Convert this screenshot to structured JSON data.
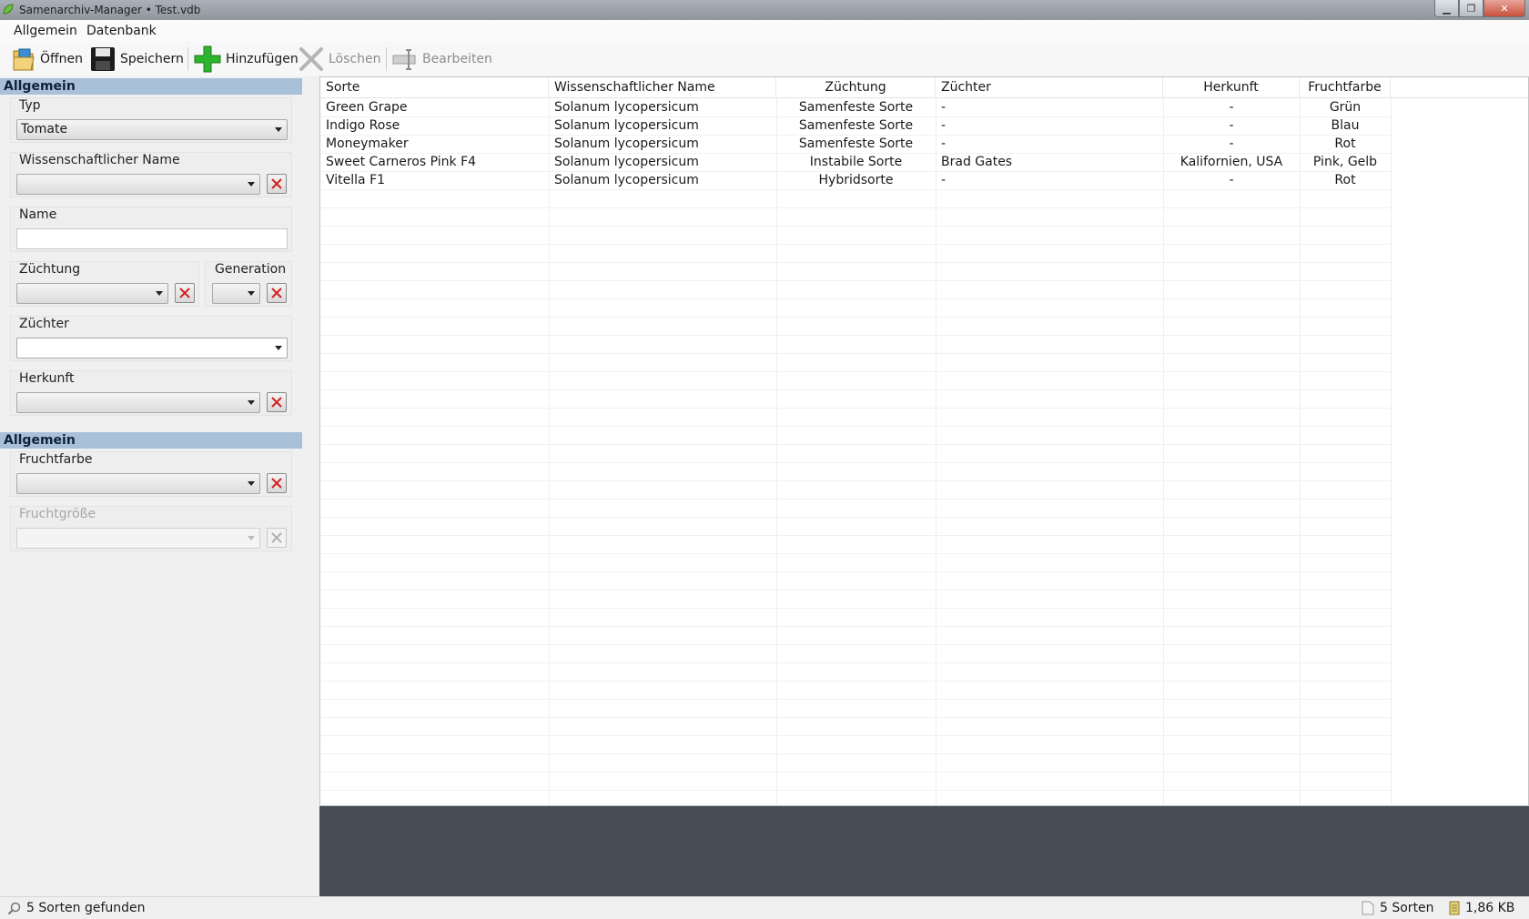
{
  "window": {
    "title": "Samenarchiv-Manager • Test.vdb"
  },
  "menu": {
    "items": [
      "Allgemein",
      "Datenbank"
    ]
  },
  "toolbar": {
    "open": "Öffnen",
    "save": "Speichern",
    "add": "Hinzufügen",
    "delete": "Löschen",
    "edit": "Bearbeiten"
  },
  "filters": {
    "section1": "Allgemein",
    "typ_label": "Typ",
    "typ_value": "Tomate",
    "sci_label": "Wissenschaftlicher Name",
    "sci_value": "",
    "name_label": "Name",
    "name_value": "",
    "zuechtung_label": "Züchtung",
    "zuechtung_value": "",
    "generation_label": "Generation",
    "generation_value": "",
    "zuechter_label": "Züchter",
    "zuechter_value": "",
    "herkunft_label": "Herkunft",
    "herkunft_value": "",
    "section2": "Allgemein",
    "fruchtfarbe_label": "Fruchtfarbe",
    "fruchtfarbe_value": "",
    "fruchtgroesse_label": "Fruchtgröße",
    "fruchtgroesse_value": ""
  },
  "table": {
    "columns": [
      "Sorte",
      "Wissenschaftlicher Name",
      "Züchtung",
      "Züchter",
      "Herkunft",
      "Fruchtfarbe"
    ],
    "rows": [
      [
        "Green Grape",
        "Solanum lycopersicum",
        "Samenfeste Sorte",
        "-",
        "-",
        "Grün"
      ],
      [
        "Indigo Rose",
        "Solanum lycopersicum",
        "Samenfeste Sorte",
        "-",
        "-",
        "Blau"
      ],
      [
        "Moneymaker",
        "Solanum lycopersicum",
        "Samenfeste Sorte",
        "-",
        "-",
        "Rot"
      ],
      [
        "Sweet Carneros Pink F4",
        "Solanum lycopersicum",
        "Instabile Sorte",
        "Brad Gates",
        "Kalifornien, USA",
        "Pink, Gelb"
      ],
      [
        "Vitella F1",
        "Solanum lycopersicum",
        "Hybridsorte",
        "-",
        "-",
        "Rot"
      ]
    ]
  },
  "status": {
    "found": "5 Sorten gefunden",
    "count": "5 Sorten",
    "size": "1,86 KB"
  },
  "colors": {
    "section_header": "#a9c0d9",
    "dark_pane": "#464d55",
    "add_icon": "#2db52d",
    "clear_icon": "#d22020"
  }
}
